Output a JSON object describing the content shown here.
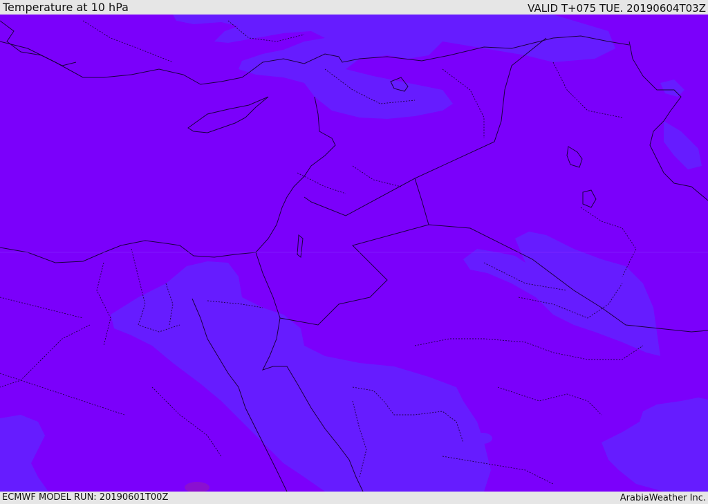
{
  "header": {
    "title": "Temperature at 10 hPa",
    "valid": "VALID T+075 TUE. 20190604T03Z"
  },
  "footer": {
    "model_run": "ECMWF MODEL RUN: 20190601T00Z",
    "credit": "ArabiaWeather Inc."
  },
  "map": {
    "field": "Temperature at 10 hPa",
    "colors": {
      "background_field": "#7b00fb",
      "warmer_band": "#661cff",
      "border_line": "#1a0040",
      "frame": "#e6e6e6"
    },
    "icons": [
      "coastline",
      "country-borders",
      "province-borders"
    ]
  }
}
